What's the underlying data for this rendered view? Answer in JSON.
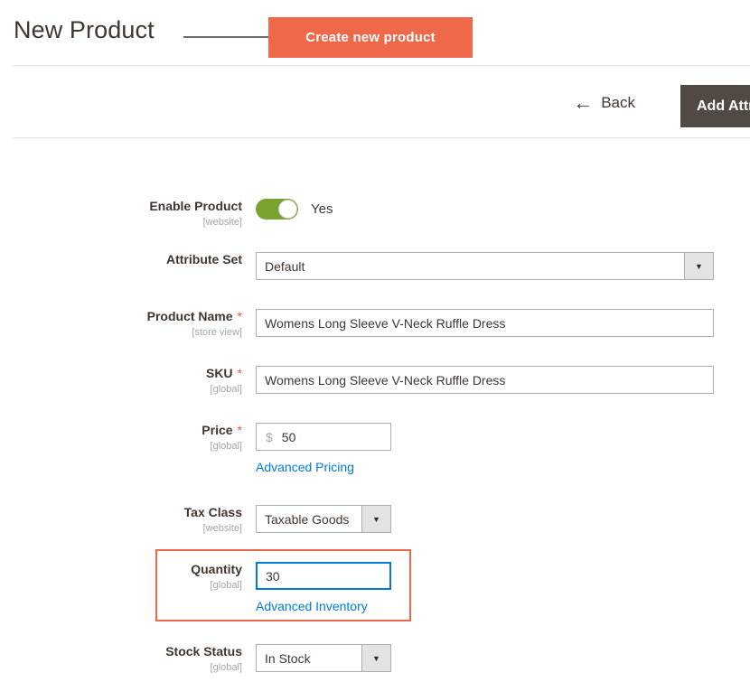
{
  "header": {
    "title": "New Product",
    "callout_label": "Create new product",
    "callout_color": "#f0684a"
  },
  "actions": {
    "back_label": "Back",
    "back_icon": "arrow-left-icon",
    "add_attribute_label": "Add Attribute",
    "add_attribute_color": "#514943"
  },
  "form": {
    "fields": {
      "enable_product": {
        "label": "Enable Product",
        "scope": "[website]",
        "toggle_value": "Yes",
        "toggle_on": true,
        "toggle_color": "#79a22e"
      },
      "attribute_set": {
        "label": "Attribute Set",
        "value": "Default"
      },
      "product_name": {
        "label": "Product Name",
        "scope": "[store view]",
        "required_marker": "*",
        "value": "Womens Long Sleeve V-Neck Ruffle Dress"
      },
      "sku": {
        "label": "SKU",
        "scope": "[global]",
        "required_marker": "*",
        "value": "Womens Long Sleeve V-Neck Ruffle Dress"
      },
      "price": {
        "label": "Price",
        "scope": "[global]",
        "required_marker": "*",
        "currency": "$",
        "value": "50",
        "link_label": "Advanced Pricing"
      },
      "tax_class": {
        "label": "Tax Class",
        "scope": "[website]",
        "value": "Taxable Goods"
      },
      "quantity": {
        "label": "Quantity",
        "scope": "[global]",
        "value": "30",
        "link_label": "Advanced Inventory",
        "focused": true,
        "highlight_color": "#f0684a"
      },
      "stock_status": {
        "label": "Stock Status",
        "scope": "[global]",
        "value": "In Stock"
      }
    }
  }
}
